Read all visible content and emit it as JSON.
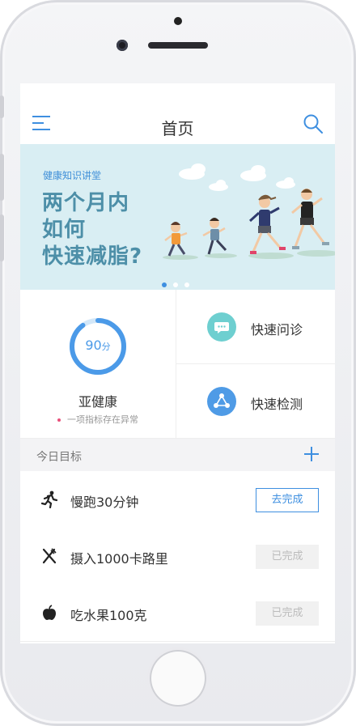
{
  "header": {
    "title": "首页"
  },
  "banner": {
    "subtitle": "健康知识讲堂",
    "title_lines": [
      "两个月内",
      "如何",
      "快速减脂?"
    ],
    "active_dot": 0
  },
  "health": {
    "score": "90",
    "score_unit": "分",
    "score_value": 90,
    "status": "亚健康",
    "note": "一项指标存在异常"
  },
  "quick_actions": [
    {
      "label": "快速问诊",
      "icon": "chat-icon",
      "color": "#6ecfd0"
    },
    {
      "label": "快速检测",
      "icon": "share-nodes-icon",
      "color": "#4f9be6"
    }
  ],
  "goals": {
    "section_title": "今日目标",
    "items": [
      {
        "text": "慢跑30分钟",
        "icon": "running-icon",
        "button": "去完成",
        "done": false
      },
      {
        "text": "摄入1000卡路里",
        "icon": "cutlery-icon",
        "button": "已完成",
        "done": true
      },
      {
        "text": "吃水果100克",
        "icon": "apple-icon",
        "button": "已完成",
        "done": true
      }
    ]
  },
  "colors": {
    "accent": "#3e8fe0",
    "banner_bg": "#d9eef3",
    "banner_title": "#4d8fa8"
  }
}
